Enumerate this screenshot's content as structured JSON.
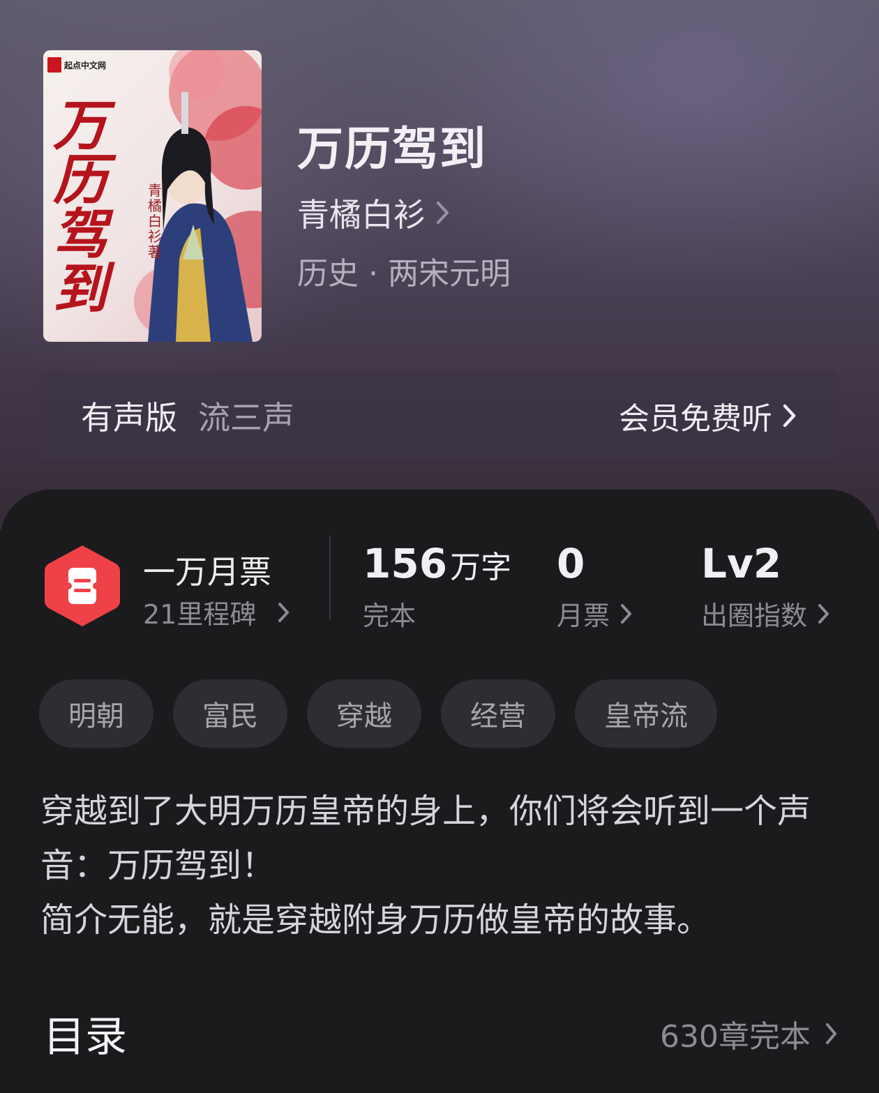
{
  "book": {
    "title": "万历驾到",
    "author": "青橘白衫",
    "genre": "历史 · 两宋元明",
    "cover": {
      "publisher_logo": "起点中文网",
      "title_text": "万历驾到",
      "author_text": "青橘白衫著"
    }
  },
  "audio": {
    "label": "有声版",
    "narrator": "流三声",
    "action": "会员免费听"
  },
  "stats": {
    "ticket_title": "一万月票",
    "ticket_sub": "21里程碑",
    "words_value": "156",
    "words_unit": "万字",
    "words_label": "完本",
    "votes_value": "0",
    "votes_label": "月票",
    "index_value": "Lv2",
    "index_label": "出圈指数"
  },
  "tags": [
    "明朝",
    "富民",
    "穿越",
    "经营",
    "皇帝流"
  ],
  "intro": {
    "line1": "穿越到了大明万历皇帝的身上，你们将会听到一个声音：万历驾到！",
    "line2": "简介无能，就是穿越附身万历做皇帝的故事。"
  },
  "toc": {
    "title": "目录",
    "meta": "630章完本"
  },
  "colors": {
    "accent_red": "#f0444a",
    "sheet_bg": "#1b1a1d"
  }
}
